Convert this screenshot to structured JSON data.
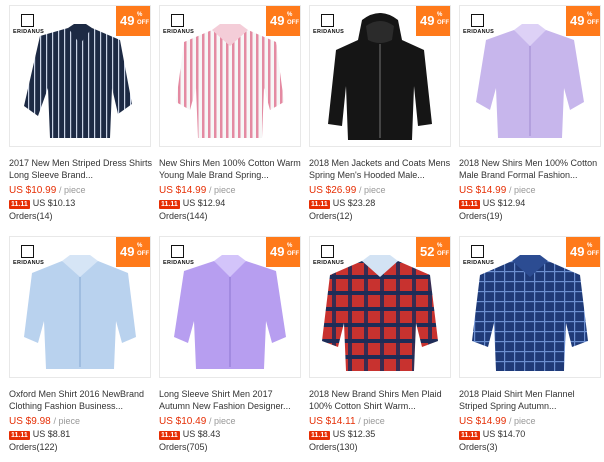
{
  "brand_logo_text": "ERIDANUS",
  "badge_off": "OFF",
  "badge_pct": "%",
  "promo_tag": "11.11",
  "unit": "/ piece",
  "products": [
    {
      "title": "2017 New Men Striped Dress Shirts Long Sleeve Brand...",
      "price": "US $10.99",
      "promo_price": "US $10.13",
      "orders": "Orders(14)",
      "discount": "49",
      "logo": true
    },
    {
      "title": "New Shirs Men 100% Cotton Warm Young Male Brand Spring...",
      "price": "US $14.99",
      "promo_price": "US $12.94",
      "orders": "Orders(144)",
      "discount": "49",
      "logo": true
    },
    {
      "title": "2018 Men Jackets and Coats Mens Spring Men's Hooded Male...",
      "price": "US $26.99",
      "promo_price": "US $23.28",
      "orders": "Orders(12)",
      "discount": "49",
      "logo": true
    },
    {
      "title": "2018 New Shirs Men 100% Cotton Male Brand Formal Fashion...",
      "price": "US $14.99",
      "promo_price": "US $12.94",
      "orders": "Orders(19)",
      "discount": "49",
      "logo": true
    },
    {
      "title": "Oxford Men Shirt 2016 NewBrand Clothing Fashion Business...",
      "price": "US $9.98",
      "promo_price": "US $8.81",
      "orders": "Orders(122)",
      "discount": "49",
      "logo": true
    },
    {
      "title": "Long Sleeve Shirt Men 2017 Autumn New Fashion Designer...",
      "price": "US $10.49",
      "promo_price": "US $8.43",
      "orders": "Orders(705)",
      "discount": "49",
      "logo": true
    },
    {
      "title": "2018 New Brand Shirs Men Plaid 100% Cotton Shirt Warm...",
      "price": "US $14.11",
      "promo_price": "US $12.35",
      "orders": "Orders(130)",
      "discount": "52",
      "logo": true
    },
    {
      "title": "2018 Plaid Shirt Men Flannel Striped Spring Autumn...",
      "price": "US $14.99",
      "promo_price": "US $14.70",
      "orders": "Orders(3)",
      "discount": "49",
      "logo": true
    }
  ],
  "colors": {
    "badge": "#ff7a1a",
    "price": "#e62e04"
  }
}
